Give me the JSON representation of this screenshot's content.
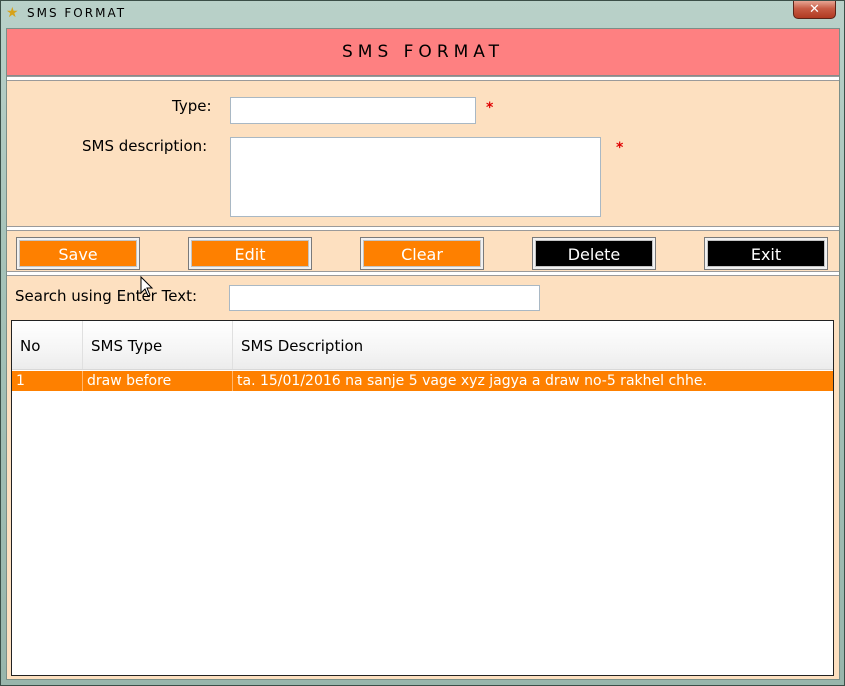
{
  "window": {
    "title": "SMS FORMAT",
    "close_label": "✕"
  },
  "form": {
    "header": "SMS FORMAT",
    "type_label": "Type:",
    "type_value": "",
    "description_label": "SMS description:",
    "description_value": "",
    "required_mark": "*"
  },
  "buttons": {
    "save": "Save",
    "edit": "Edit",
    "clear": "Clear",
    "delete": "Delete",
    "exit": "Exit"
  },
  "search": {
    "label": "Search using Enter Text:",
    "value": ""
  },
  "table": {
    "columns": [
      "No",
      "SMS Type",
      "SMS Description"
    ],
    "rows": [
      [
        "1",
        "draw before",
        "ta. 15/01/2016 na sanje 5 vage xyz jagya a draw no-5 rakhel chhe."
      ]
    ]
  },
  "colors": {
    "header_bg": "#fe8081",
    "panel_bg": "#fde0c0",
    "action_orange": "#fe8000",
    "action_black": "#000000",
    "required": "#e00000"
  }
}
